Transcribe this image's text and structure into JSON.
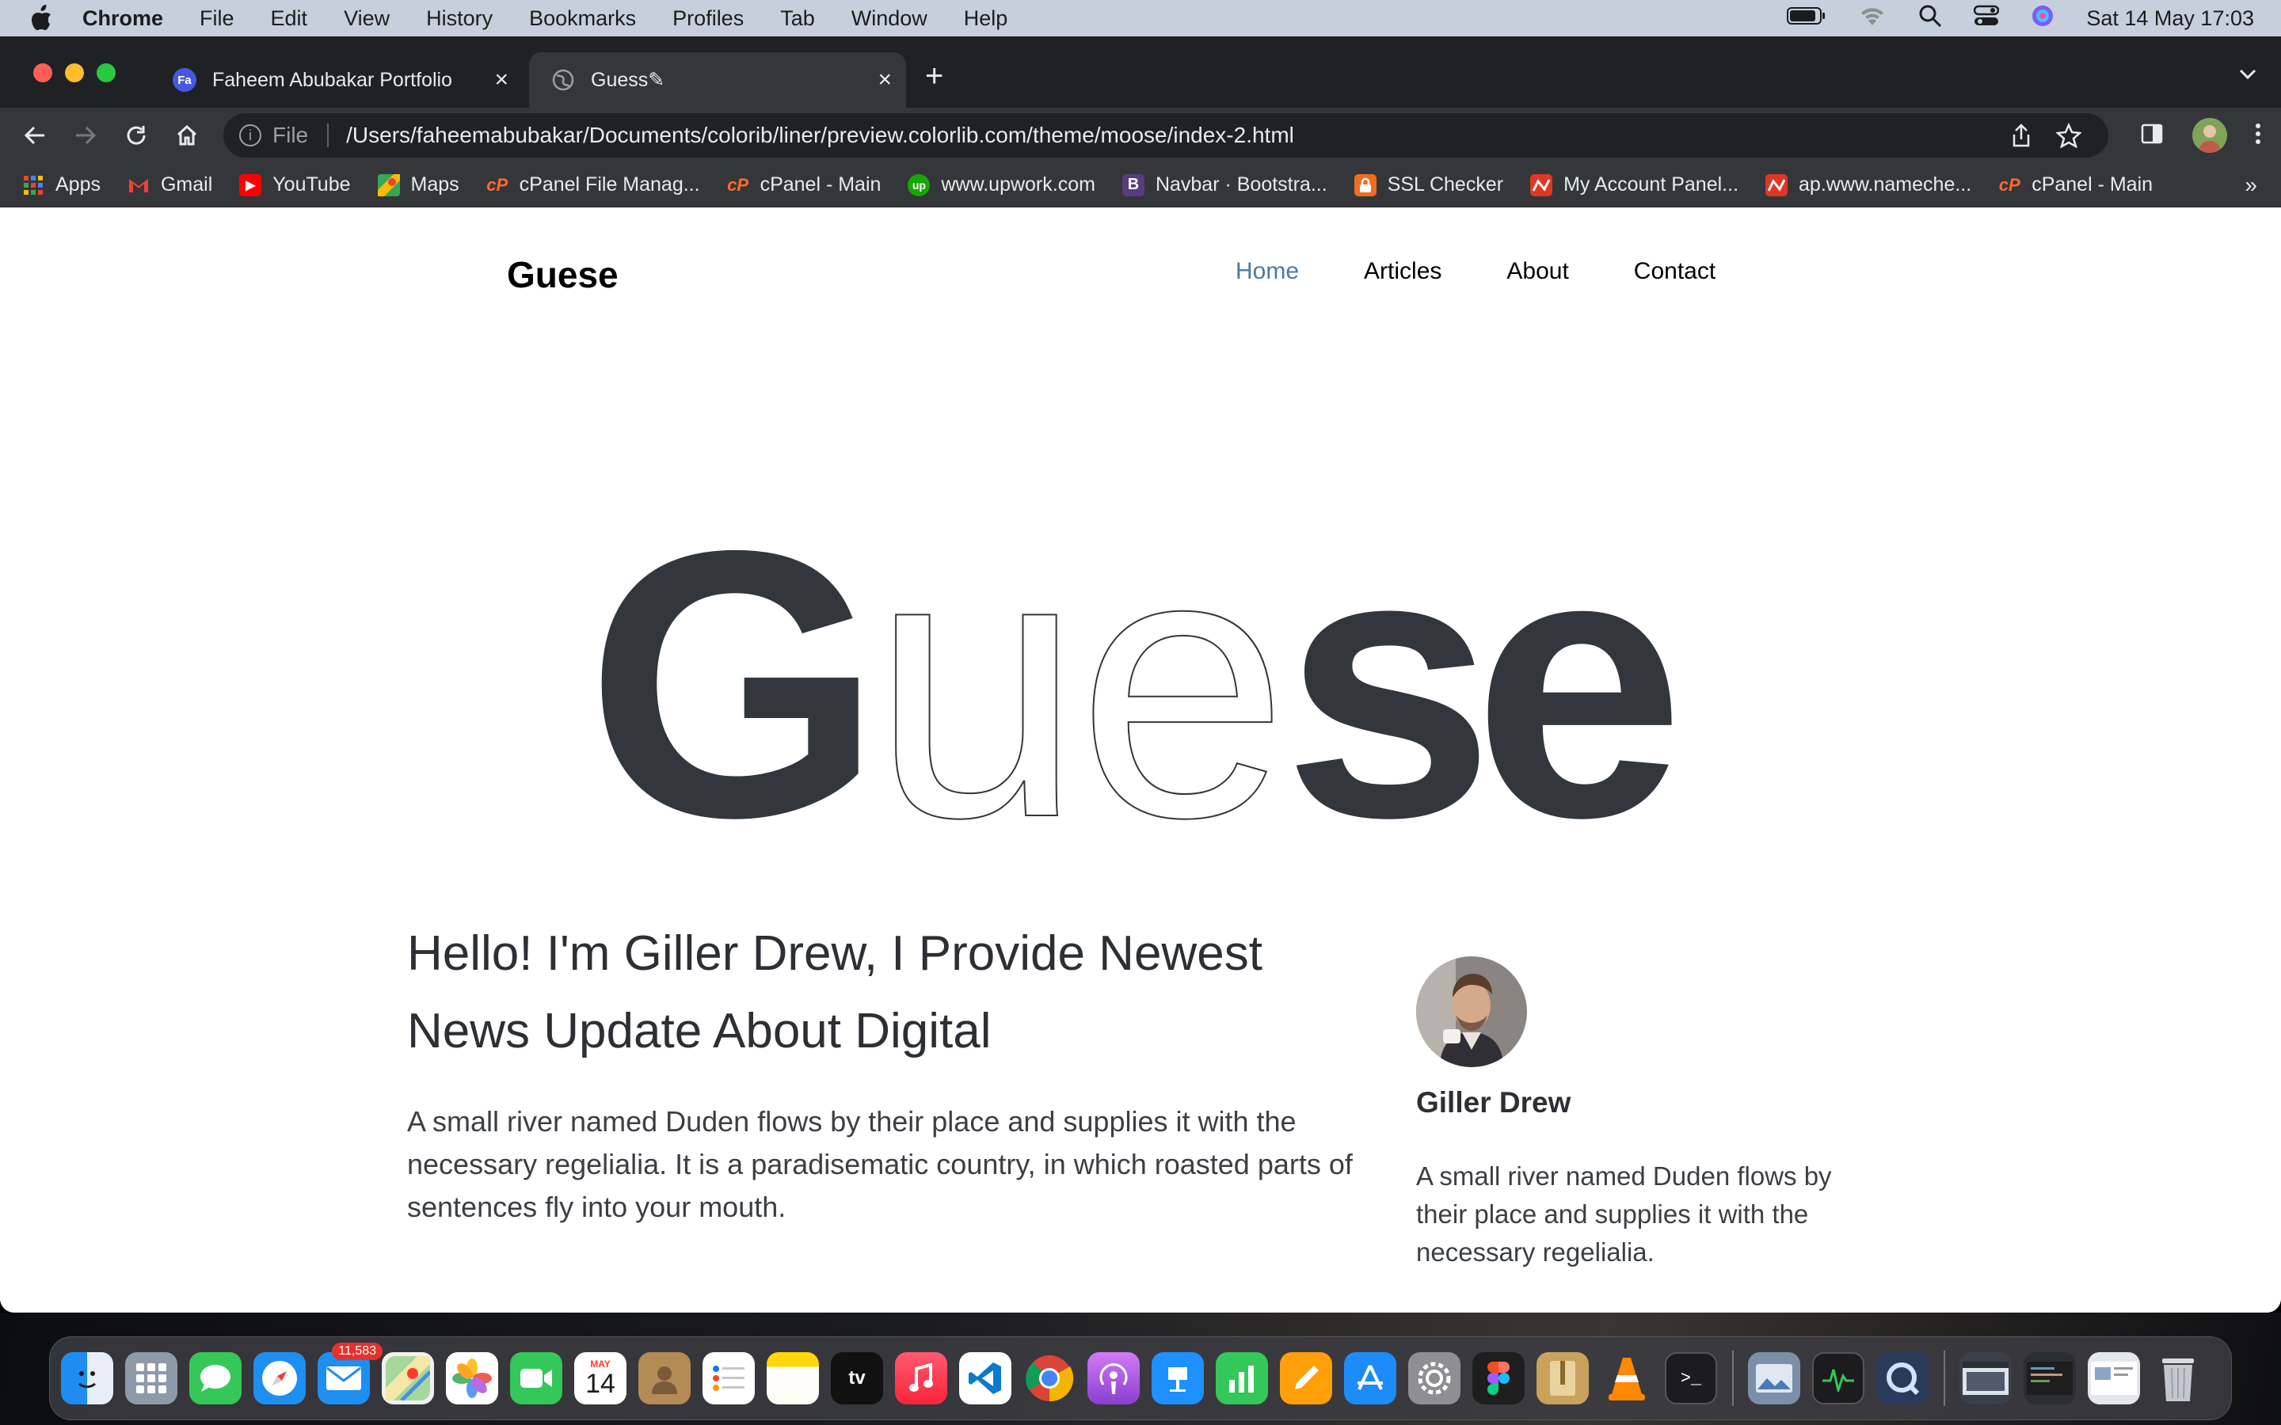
{
  "menubar": {
    "app_name": "Chrome",
    "items": [
      "File",
      "Edit",
      "View",
      "History",
      "Bookmarks",
      "Profiles",
      "Tab",
      "Window",
      "Help"
    ],
    "clock": "Sat 14 May  17:03"
  },
  "tabs": [
    {
      "title": "Faheem Abubakar Portfolio",
      "favicon": "Fa",
      "active": false
    },
    {
      "title": "Guess✎",
      "favicon": "globe-icon",
      "active": true
    }
  ],
  "omnibox": {
    "scheme": "File",
    "url": "/Users/faheemabubakar/Documents/colorib/liner/preview.colorlib.com/theme/moose/index-2.html"
  },
  "bookmarks": [
    {
      "label": "Apps",
      "icon": "apps-grid-icon"
    },
    {
      "label": "Gmail",
      "icon": "gmail-icon"
    },
    {
      "label": "YouTube",
      "icon": "youtube-icon"
    },
    {
      "label": "Maps",
      "icon": "maps-icon"
    },
    {
      "label": "cPanel File Manag...",
      "icon": "cpanel-icon"
    },
    {
      "label": "cPanel - Main",
      "icon": "cpanel-icon"
    },
    {
      "label": "www.upwork.com",
      "icon": "upwork-icon"
    },
    {
      "label": "Navbar · Bootstra...",
      "icon": "bootstrap-icon"
    },
    {
      "label": "SSL Checker",
      "icon": "lock-icon"
    },
    {
      "label": "My Account Panel...",
      "icon": "namecheap-icon"
    },
    {
      "label": "ap.www.nameche...",
      "icon": "namecheap-icon"
    },
    {
      "label": "cPanel - Main",
      "icon": "cpanel-icon"
    }
  ],
  "site": {
    "logo": "Guese",
    "nav": [
      "Home",
      "Articles",
      "About",
      "Contact"
    ],
    "active_nav": "Home",
    "hero_word": {
      "filled_1": "G",
      "outline_1": "u",
      "outline_2": "e",
      "filled_2": "s",
      "filled_3": "e"
    },
    "intro_title": "Hello! I'm Giller Drew, I Provide Newest News Update About Digital",
    "intro_text": "A small river named Duden flows by their place and supplies it with the necessary regelialia. It is a paradisematic country, in which roasted parts of sentences fly into your mouth.",
    "author": {
      "name": "Giller Drew",
      "bio": "A small river named Duden flows by their place and supplies it with the necessary regelialia."
    }
  },
  "dock": {
    "mail_badge": "11,583",
    "calendar_month": "MAY",
    "calendar_day": "14",
    "tv_label": "tv"
  },
  "colors": {
    "hero_fill": "#32373d",
    "nav_active": "#4a7aa6",
    "tab_strip": "#202124",
    "toolbar": "#35363a"
  }
}
